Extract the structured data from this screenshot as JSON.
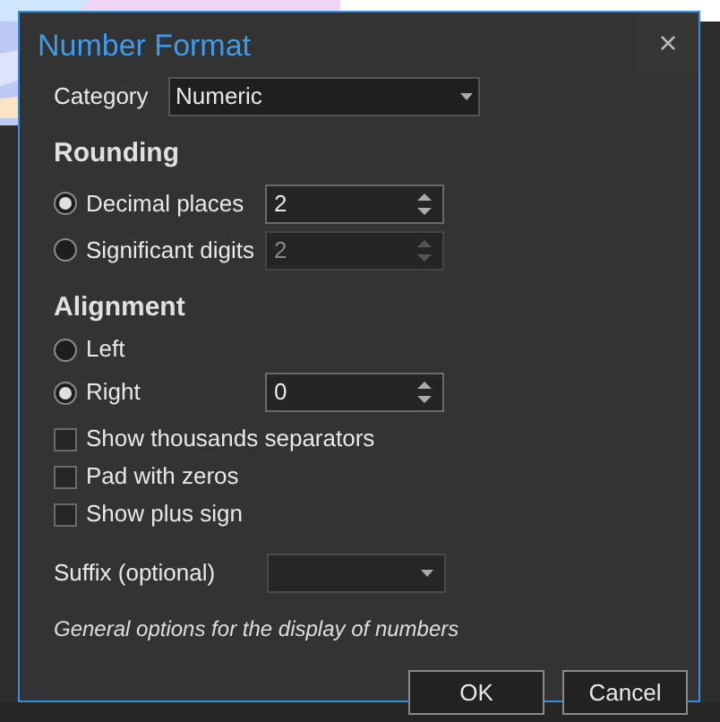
{
  "dialog": {
    "title": "Number Format",
    "close": "×"
  },
  "category": {
    "label": "Category",
    "value": "Numeric"
  },
  "rounding": {
    "heading": "Rounding",
    "options": [
      {
        "label": "Decimal places",
        "selected": true,
        "value": "2",
        "disabled": false
      },
      {
        "label": "Significant digits",
        "selected": false,
        "value": "2",
        "disabled": true
      }
    ]
  },
  "alignment": {
    "heading": "Alignment",
    "options": [
      {
        "label": "Left",
        "selected": false
      },
      {
        "label": "Right",
        "selected": true,
        "value": "0",
        "disabled": false
      }
    ]
  },
  "checkboxes": [
    {
      "label": "Show thousands separators",
      "checked": false
    },
    {
      "label": "Pad with zeros",
      "checked": false
    },
    {
      "label": "Show plus sign",
      "checked": false
    }
  ],
  "suffix": {
    "label": "Suffix (optional)"
  },
  "description": "General options for the display of numbers",
  "buttons": [
    "OK",
    "Cancel"
  ]
}
